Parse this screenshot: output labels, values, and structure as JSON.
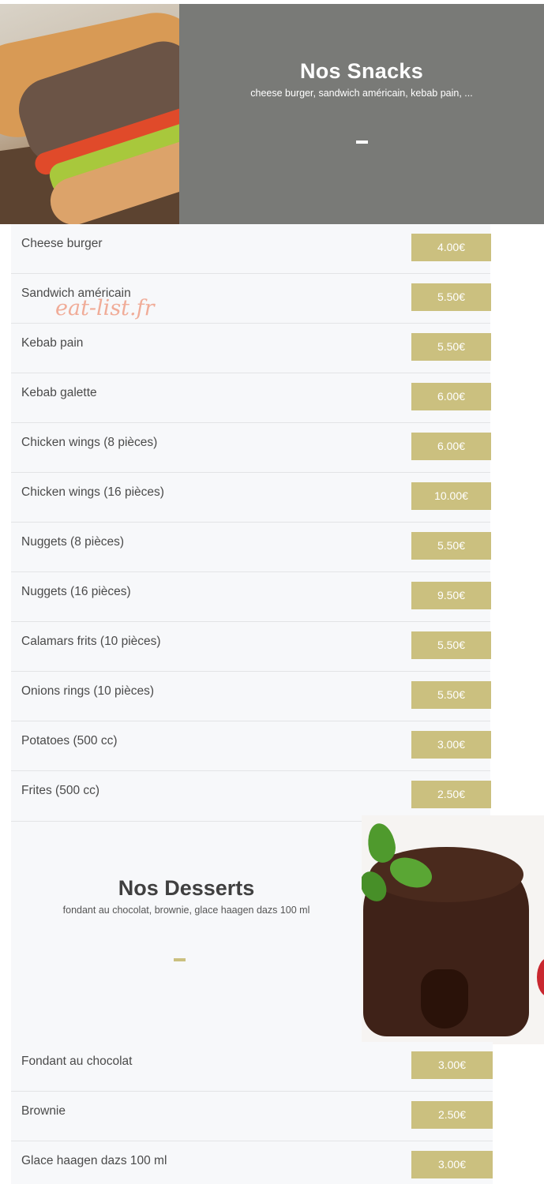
{
  "snacks": {
    "title": "Nos Snacks",
    "subtitle": "cheese burger, sandwich américain, kebab pain, ...",
    "items": [
      {
        "name": "Cheese burger",
        "price": "4.00€"
      },
      {
        "name": "Sandwich américain",
        "price": "5.50€"
      },
      {
        "name": "Kebab pain",
        "price": "5.50€"
      },
      {
        "name": "Kebab galette",
        "price": "6.00€"
      },
      {
        "name": "Chicken wings (8 pièces)",
        "price": "6.00€"
      },
      {
        "name": "Chicken wings (16 pièces)",
        "price": "10.00€"
      },
      {
        "name": "Nuggets (8 pièces)",
        "price": "5.50€"
      },
      {
        "name": "Nuggets (16 pièces)",
        "price": "9.50€"
      },
      {
        "name": "Calamars frits (10 pièces)",
        "price": "5.50€"
      },
      {
        "name": "Onions rings (10 pièces)",
        "price": "5.50€"
      },
      {
        "name": "Potatoes (500 cc)",
        "price": "3.00€"
      },
      {
        "name": "Frites (500 cc)",
        "price": "2.50€"
      }
    ]
  },
  "desserts": {
    "title": "Nos Desserts",
    "subtitle": "fondant au chocolat, brownie, glace haagen dazs 100 ml",
    "items": [
      {
        "name": "Fondant au chocolat",
        "price": "3.00€"
      },
      {
        "name": "Brownie",
        "price": "2.50€"
      },
      {
        "name": "Glace haagen dazs 100 ml",
        "price": "3.00€"
      }
    ]
  },
  "watermark": "eat-list.fr",
  "colors": {
    "price_badge": "#cbc07f",
    "snack_banner": "#797a77",
    "list_background": "#f7f8fa"
  },
  "icons": {
    "snack_image": "sandwich-photo",
    "dessert_image": "chocolate-fondant-photo"
  }
}
